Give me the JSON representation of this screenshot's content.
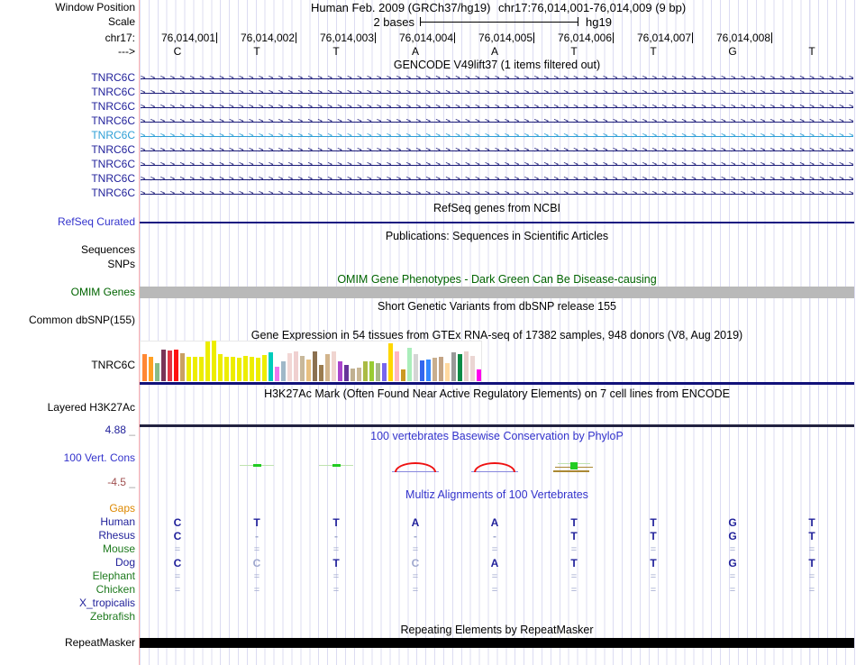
{
  "header": {
    "window_position_label": "Window Position",
    "genome": "Human Feb. 2009 (GRCh37/hg19)",
    "position": "chr17:76,014,001-76,014,009 (9 bp)",
    "scale_label": "Scale",
    "scale_text": "2 bases",
    "scale_assembly": "hg19",
    "chrom_label": "chr17:",
    "strand_label": "--->",
    "coordinates": [
      "76,014,001",
      "76,014,002",
      "76,014,003",
      "76,014,004",
      "76,014,005",
      "76,014,006",
      "76,014,007",
      "76,014,008"
    ],
    "bases": [
      "C",
      "T",
      "T",
      "A",
      "A",
      "T",
      "T",
      "G",
      "T"
    ]
  },
  "tracks": {
    "gencode": {
      "title": "GENCODE V49lift37 (1 items filtered out)",
      "gene_rows": [
        {
          "label": "TNRC6C",
          "highlighted": false
        },
        {
          "label": "TNRC6C",
          "highlighted": false
        },
        {
          "label": "TNRC6C",
          "highlighted": false
        },
        {
          "label": "TNRC6C",
          "highlighted": false
        },
        {
          "label": "TNRC6C",
          "highlighted": true
        },
        {
          "label": "TNRC6C",
          "highlighted": false
        },
        {
          "label": "TNRC6C",
          "highlighted": false
        },
        {
          "label": "TNRC6C",
          "highlighted": false
        },
        {
          "label": "TNRC6C",
          "highlighted": false
        }
      ]
    },
    "refseq": {
      "title": "RefSeq genes from NCBI",
      "label": "RefSeq Curated"
    },
    "publications": {
      "title": "Publications: Sequences in Scientific Articles",
      "labels": [
        "Sequences",
        "SNPs"
      ]
    },
    "omim": {
      "title": "OMIM Gene Phenotypes - Dark Green Can Be Disease-causing",
      "label": "OMIM Genes"
    },
    "dbsnp": {
      "title": "Short Genetic Variants from dbSNP release 155",
      "label": "Common dbSNP(155)"
    },
    "gtex": {
      "title": "Gene Expression in 54 tissues from GTEx RNA-seq of 17382 samples, 948 donors (V8, Aug 2019)",
      "label": "TNRC6C"
    },
    "h3k27ac": {
      "title": "H3K27Ac Mark (Often Found Near Active Regulatory Elements) on 7 cell lines from ENCODE",
      "label": "Layered H3K27Ac"
    },
    "phylop": {
      "title": "100 vertebrates Basewise Conservation by PhyloP",
      "label": "100 Vert. Cons",
      "max": "4.88",
      "min": "-4.5"
    },
    "multiz": {
      "title": "Multiz Alignments of 100 Vertebrates",
      "gaps_label": "Gaps",
      "species": [
        {
          "name": "Human",
          "label_color": "#22229B",
          "bases": [
            "C",
            "T",
            "T",
            "A",
            "A",
            "T",
            "T",
            "G",
            "T"
          ],
          "dim": [
            0,
            0,
            0,
            0,
            0,
            0,
            0,
            0,
            0
          ]
        },
        {
          "name": "Rhesus",
          "label_color": "#22229B",
          "bases": [
            "C",
            "-",
            "-",
            "-",
            "-",
            "T",
            "T",
            "G",
            "T"
          ],
          "dim": [
            0,
            1,
            1,
            1,
            1,
            0,
            0,
            0,
            0
          ]
        },
        {
          "name": "Mouse",
          "label_color": "#1E7A1E",
          "bases": [
            "=",
            "=",
            "=",
            "=",
            "=",
            "=",
            "=",
            "=",
            "="
          ],
          "dim": [
            1,
            1,
            1,
            1,
            1,
            1,
            1,
            1,
            1
          ]
        },
        {
          "name": "Dog",
          "label_color": "#22229B",
          "bases": [
            "C",
            "C",
            "T",
            "C",
            "A",
            "T",
            "T",
            "G",
            "T"
          ],
          "dim": [
            0,
            1,
            0,
            1,
            0,
            0,
            0,
            0,
            0
          ]
        },
        {
          "name": "Elephant",
          "label_color": "#1E7A1E",
          "bases": [
            "=",
            "=",
            "=",
            "=",
            "=",
            "=",
            "=",
            "=",
            "="
          ],
          "dim": [
            1,
            1,
            1,
            1,
            1,
            1,
            1,
            1,
            1
          ]
        },
        {
          "name": "Chicken",
          "label_color": "#1E7A1E",
          "bases": [
            "=",
            "=",
            "=",
            "=",
            "=",
            "=",
            "=",
            "=",
            "="
          ],
          "dim": [
            1,
            1,
            1,
            1,
            1,
            1,
            1,
            1,
            1
          ]
        },
        {
          "name": "X_tropicalis",
          "label_color": "#22229B",
          "bases": [
            "",
            "",
            "",
            "",
            "",
            "",
            "",
            "",
            ""
          ],
          "dim": [
            0,
            0,
            0,
            0,
            0,
            0,
            0,
            0,
            0
          ]
        },
        {
          "name": "Zebrafish",
          "label_color": "#1E7A1E",
          "bases": [
            "",
            "",
            "",
            "",
            "",
            "",
            "",
            "",
            ""
          ],
          "dim": [
            0,
            0,
            0,
            0,
            0,
            0,
            0,
            0,
            0
          ]
        }
      ]
    },
    "repeatmasker": {
      "title": "Repeating Elements by RepeatMasker",
      "label": "RepeatMasker"
    }
  },
  "conservation_glyphs": [
    {
      "kind": "green-dash",
      "col": 1
    },
    {
      "kind": "green-dash",
      "col": 2
    },
    {
      "kind": "red-arc",
      "col": 3
    },
    {
      "kind": "red-arc",
      "col": 4
    },
    {
      "kind": "olive-mark",
      "col": 5
    }
  ],
  "chart_data": {
    "type": "bar",
    "title": "Gene Expression in 54 tissues from GTEx RNA-seq of 17382 samples, 948 donors (V8, Aug 2019)",
    "gene": "TNRC6C",
    "note": "54 tissue bars left-to-right; tissue names not rendered in image; values are approximate bar heights in pixels",
    "values": [
      30,
      27,
      20,
      35,
      34,
      35,
      31,
      27,
      27,
      27,
      44,
      45,
      30,
      27,
      27,
      26,
      28,
      27,
      26,
      29,
      32,
      16,
      22,
      31,
      33,
      28,
      24,
      33,
      18,
      30,
      33,
      22,
      18,
      14,
      15,
      22,
      22,
      20,
      20,
      42,
      33,
      13,
      37,
      30,
      23,
      24,
      26,
      27,
      20,
      32,
      30,
      33,
      28,
      13
    ],
    "bar_colors": [
      "#FF8833",
      "#FFA022",
      "#88BB88",
      "#7A3558",
      "#E03545",
      "#FF1111",
      "#C8A064",
      "#EDED00",
      "#EDED00",
      "#EDED00",
      "#EDED00",
      "#EDED00",
      "#EDED00",
      "#EDED00",
      "#EDED00",
      "#EDED00",
      "#EDED00",
      "#EDED00",
      "#EDED00",
      "#EDED00",
      "#00CCBB",
      "#EE77EE",
      "#9FB8C8",
      "#F2D7D5",
      "#F0D0D0",
      "#C8B89A",
      "#E8C080",
      "#8B7050",
      "#9A7B4F",
      "#D2B48C",
      "#F0D5D0",
      "#AA44CC",
      "#663399",
      "#C0B090",
      "#C9B795",
      "#AABB44",
      "#99CC33",
      "#A8B888",
      "#7766EE",
      "#FFD700",
      "#FFB6C1",
      "#CC9922",
      "#AAEEBB",
      "#D5D5D5",
      "#3366EE",
      "#3388FF",
      "#C8AE8E",
      "#C4A484",
      "#FFD9A0",
      "#999999",
      "#0A8A45",
      "#E8D0CC",
      "#EBD6D3",
      "#FF00EE"
    ]
  },
  "colors": {
    "navy": "#22229B",
    "blue_link": "#3333CC",
    "dark_green": "#006400",
    "orange": "#DD8800",
    "brick": "#A05050",
    "highlight_blue": "#2E9FD6",
    "arrow_navy": "#1B1B78",
    "grid": "#DCDCF2"
  }
}
